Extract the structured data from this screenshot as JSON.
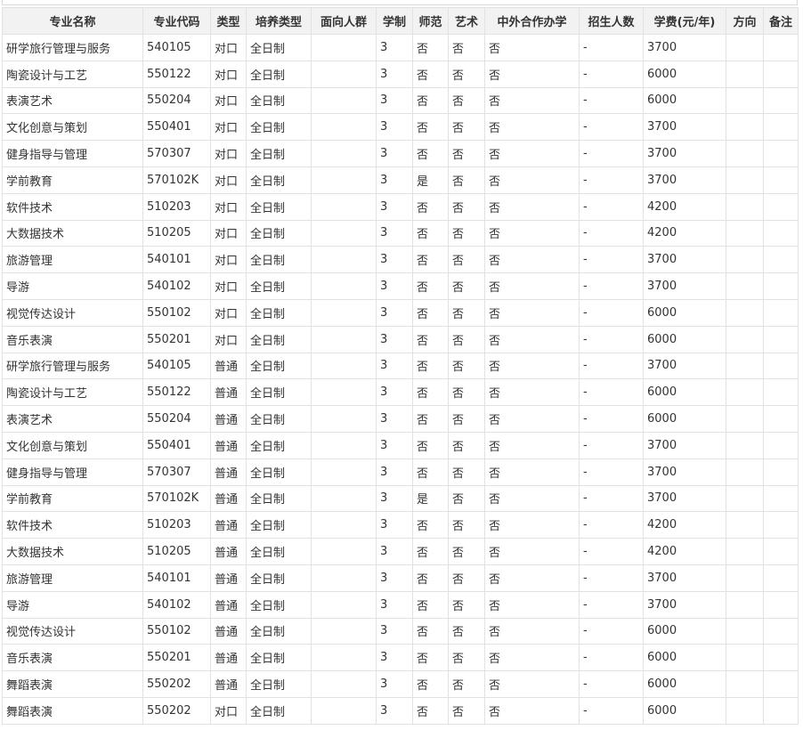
{
  "table": {
    "headers": [
      "专业名称",
      "专业代码",
      "类型",
      "培养类型",
      "面向人群",
      "学制",
      "师范",
      "艺术",
      "中外合作办学",
      "招生人数",
      "学费(元/年)",
      "方向",
      "备注"
    ],
    "rows": [
      [
        "研学旅行管理与服务",
        "540105",
        "对口",
        "全日制",
        "",
        "3",
        "否",
        "否",
        "否",
        "-",
        "3700",
        "",
        ""
      ],
      [
        "陶瓷设计与工艺",
        "550122",
        "对口",
        "全日制",
        "",
        "3",
        "否",
        "否",
        "否",
        "-",
        "6000",
        "",
        ""
      ],
      [
        "表演艺术",
        "550204",
        "对口",
        "全日制",
        "",
        "3",
        "否",
        "否",
        "否",
        "-",
        "6000",
        "",
        ""
      ],
      [
        "文化创意与策划",
        "550401",
        "对口",
        "全日制",
        "",
        "3",
        "否",
        "否",
        "否",
        "-",
        "3700",
        "",
        ""
      ],
      [
        "健身指导与管理",
        "570307",
        "对口",
        "全日制",
        "",
        "3",
        "否",
        "否",
        "否",
        "-",
        "3700",
        "",
        ""
      ],
      [
        "学前教育",
        "570102K",
        "对口",
        "全日制",
        "",
        "3",
        "是",
        "否",
        "否",
        "-",
        "3700",
        "",
        ""
      ],
      [
        "软件技术",
        "510203",
        "对口",
        "全日制",
        "",
        "3",
        "否",
        "否",
        "否",
        "-",
        "4200",
        "",
        ""
      ],
      [
        "大数据技术",
        "510205",
        "对口",
        "全日制",
        "",
        "3",
        "否",
        "否",
        "否",
        "-",
        "4200",
        "",
        ""
      ],
      [
        "旅游管理",
        "540101",
        "对口",
        "全日制",
        "",
        "3",
        "否",
        "否",
        "否",
        "-",
        "3700",
        "",
        ""
      ],
      [
        "导游",
        "540102",
        "对口",
        "全日制",
        "",
        "3",
        "否",
        "否",
        "否",
        "-",
        "3700",
        "",
        ""
      ],
      [
        "视觉传达设计",
        "550102",
        "对口",
        "全日制",
        "",
        "3",
        "否",
        "否",
        "否",
        "-",
        "6000",
        "",
        ""
      ],
      [
        "音乐表演",
        "550201",
        "对口",
        "全日制",
        "",
        "3",
        "否",
        "否",
        "否",
        "-",
        "6000",
        "",
        ""
      ],
      [
        "研学旅行管理与服务",
        "540105",
        "普通",
        "全日制",
        "",
        "3",
        "否",
        "否",
        "否",
        "-",
        "3700",
        "",
        ""
      ],
      [
        "陶瓷设计与工艺",
        "550122",
        "普通",
        "全日制",
        "",
        "3",
        "否",
        "否",
        "否",
        "-",
        "6000",
        "",
        ""
      ],
      [
        "表演艺术",
        "550204",
        "普通",
        "全日制",
        "",
        "3",
        "否",
        "否",
        "否",
        "-",
        "6000",
        "",
        ""
      ],
      [
        "文化创意与策划",
        "550401",
        "普通",
        "全日制",
        "",
        "3",
        "否",
        "否",
        "否",
        "-",
        "3700",
        "",
        ""
      ],
      [
        "健身指导与管理",
        "570307",
        "普通",
        "全日制",
        "",
        "3",
        "否",
        "否",
        "否",
        "-",
        "3700",
        "",
        ""
      ],
      [
        "学前教育",
        "570102K",
        "普通",
        "全日制",
        "",
        "3",
        "是",
        "否",
        "否",
        "-",
        "3700",
        "",
        ""
      ],
      [
        "软件技术",
        "510203",
        "普通",
        "全日制",
        "",
        "3",
        "否",
        "否",
        "否",
        "-",
        "4200",
        "",
        ""
      ],
      [
        "大数据技术",
        "510205",
        "普通",
        "全日制",
        "",
        "3",
        "否",
        "否",
        "否",
        "-",
        "4200",
        "",
        ""
      ],
      [
        "旅游管理",
        "540101",
        "普通",
        "全日制",
        "",
        "3",
        "否",
        "否",
        "否",
        "-",
        "3700",
        "",
        ""
      ],
      [
        "导游",
        "540102",
        "普通",
        "全日制",
        "",
        "3",
        "否",
        "否",
        "否",
        "-",
        "3700",
        "",
        ""
      ],
      [
        "视觉传达设计",
        "550102",
        "普通",
        "全日制",
        "",
        "3",
        "否",
        "否",
        "否",
        "-",
        "6000",
        "",
        ""
      ],
      [
        "音乐表演",
        "550201",
        "普通",
        "全日制",
        "",
        "3",
        "否",
        "否",
        "否",
        "-",
        "6000",
        "",
        ""
      ],
      [
        "舞蹈表演",
        "550202",
        "普通",
        "全日制",
        "",
        "3",
        "否",
        "否",
        "否",
        "-",
        "6000",
        "",
        ""
      ],
      [
        "舞蹈表演",
        "550202",
        "对口",
        "全日制",
        "",
        "3",
        "否",
        "否",
        "否",
        "-",
        "6000",
        "",
        ""
      ]
    ]
  }
}
